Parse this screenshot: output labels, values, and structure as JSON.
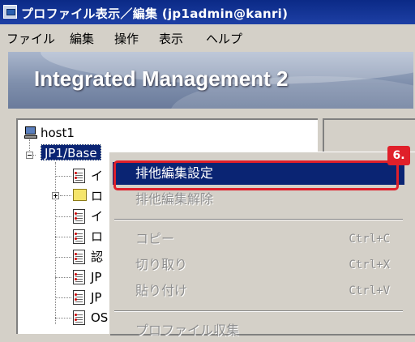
{
  "window": {
    "title": "プロファイル表示／編集 (jp1admin@kanri)",
    "icon": "app-window-icon"
  },
  "menubar": {
    "items": [
      "ファイル",
      "編集",
      "操作",
      "表示",
      "ヘルプ"
    ]
  },
  "banner": {
    "product_name": "Integrated Management 2"
  },
  "tree": {
    "host_label": "host1",
    "selected_label": "JP1/Base",
    "children": [
      "イ",
      "ロ",
      "イ",
      "ロ",
      "認",
      "JP",
      "JP",
      "OS"
    ]
  },
  "context_menu": {
    "items": [
      {
        "label": "排他編集設定",
        "state": "active"
      },
      {
        "label": "排他編集解除",
        "state": "disabled"
      },
      {
        "label": "コピー",
        "shortcut": "Ctrl+C",
        "state": "disabled"
      },
      {
        "label": "切り取り",
        "shortcut": "Ctrl+X",
        "state": "disabled"
      },
      {
        "label": "貼り付け",
        "shortcut": "Ctrl+V",
        "state": "disabled"
      },
      {
        "label": "プロファイル収集",
        "state": "disabled"
      }
    ]
  },
  "callout": {
    "step_label": "6.",
    "color": "#e0202a"
  },
  "colors": {
    "selection": "#0a2473",
    "titlebar": "#0b2a86"
  }
}
